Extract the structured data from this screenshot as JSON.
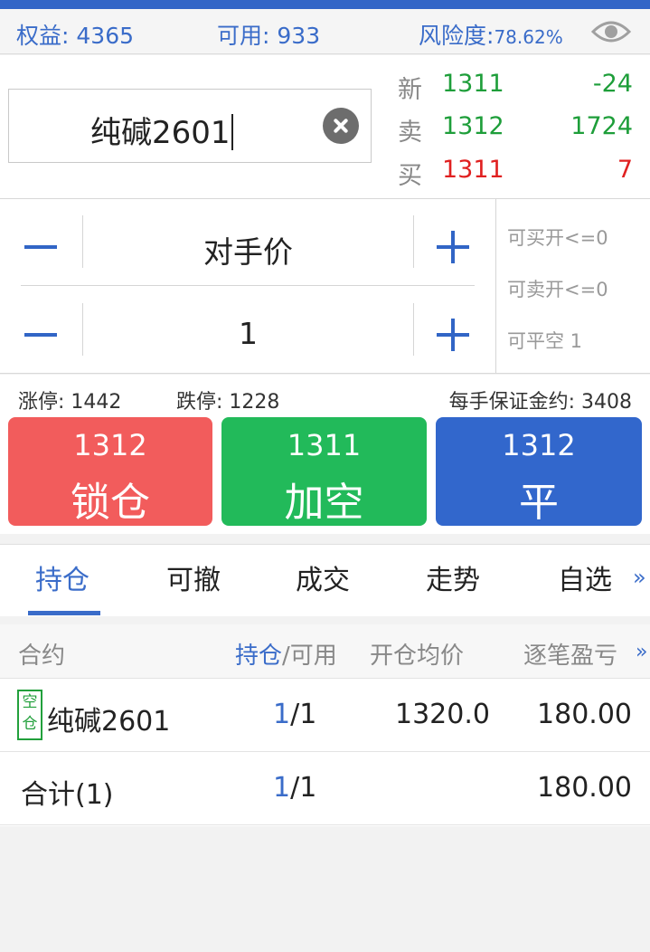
{
  "account": {
    "equity_label": "权益:",
    "equity_value": "4365",
    "available_label": "可用:",
    "available_value": "933",
    "risk_label": "风险度:",
    "risk_value": "78.62%"
  },
  "symbol": {
    "name": "纯碱2601"
  },
  "quote": {
    "last": {
      "label": "新",
      "price": "1311",
      "qty": "-24"
    },
    "ask": {
      "label": "卖",
      "price": "1312",
      "qty": "1724"
    },
    "bid": {
      "label": "买",
      "price": "1311",
      "qty": "7"
    }
  },
  "order": {
    "price_type": "对手价",
    "quantity": "1"
  },
  "availability": {
    "can_buy_open": "可买开<=0",
    "can_sell_open": "可卖开<=0",
    "can_close_short": "可平空 1"
  },
  "limits": {
    "limit_up": "涨停: 1442",
    "limit_down": "跌停: 1228",
    "margin": "每手保证金约: 3408"
  },
  "buttons": {
    "lock": {
      "price": "1312",
      "action": "锁仓",
      "color": "#f25c5c"
    },
    "add_short": {
      "price": "1311",
      "action": "加空",
      "color": "#22ba5a"
    },
    "close": {
      "price": "1312",
      "action": "平",
      "color": "#3267cc"
    }
  },
  "tabs": [
    "持仓",
    "可撤",
    "成交",
    "走势",
    "自选"
  ],
  "more_icon": "»",
  "positions": {
    "headers": {
      "contract": "合约",
      "position": "持仓",
      "slash_available": "/可用",
      "avg_price": "开仓均价",
      "pnl": "逐笔盈亏"
    },
    "rows": [
      {
        "tag": "空仓",
        "contract": "纯碱2601",
        "pos": "1",
        "avail": "/1",
        "avg": "1320.0",
        "pnl": "180.00"
      }
    ],
    "total": {
      "label": "合计(1)",
      "pos": "1",
      "avail": "/1",
      "pnl": "180.00"
    }
  },
  "colors": {
    "accent": "#3a6cc9",
    "up": "#e02020",
    "down": "#1e9e3a"
  }
}
